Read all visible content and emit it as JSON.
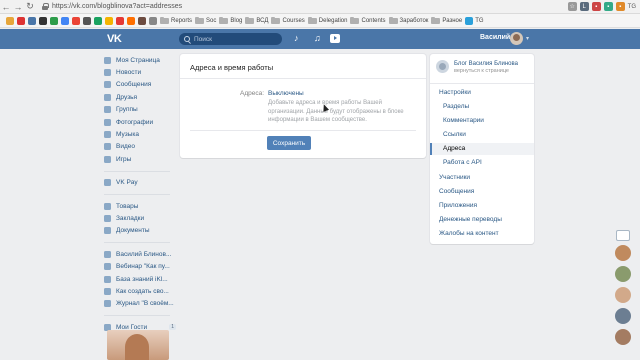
{
  "browser": {
    "url": "https://vk.com/blogblinova?act=addresses",
    "right_tg": "TG",
    "bookmarks": [
      "Reports",
      "Soc",
      "Blog",
      "ВСД",
      "Courses",
      "Delegation",
      "Contents",
      "Заработок",
      "Разное",
      "TG"
    ]
  },
  "vk_header": {
    "logo": "VK",
    "search_placeholder": "Поиск",
    "username": "Василий",
    "caret": "▾"
  },
  "left_nav": {
    "main": [
      "Моя Страница",
      "Новости",
      "Сообщения",
      "Друзья",
      "Группы",
      "Фотографии",
      "Музыка",
      "Видео",
      "Игры"
    ],
    "pay": "VK Pay",
    "extra": [
      "Товары",
      "Закладки",
      "Документы"
    ],
    "groups": [
      "Василий Блинов...",
      "Вебинар \"Как пу...",
      "База знаний iKl...",
      "Как создать сво...",
      "Журнал \"В своём..."
    ],
    "guests": "Мои Гости",
    "guests_badge": "1"
  },
  "card": {
    "title": "Адреса и время работы",
    "label": "Адреса:",
    "value": "Выключены",
    "description": "Добавьте адреса и время работы Вашей организации. Данные будут отображены в блоке информации в Вашем сообществе.",
    "save": "Сохранить"
  },
  "right_menu": {
    "group_name": "Блог Василия Блинова",
    "back": "вернуться к странице",
    "settings": "Настройки",
    "sub": [
      "Разделы",
      "Комментарии",
      "Ссылки",
      "Адреса",
      "Работа с API"
    ],
    "active": "Адреса",
    "items": [
      "Участники",
      "Сообщения",
      "Приложения",
      "Денежные переводы",
      "Жалобы на контент"
    ]
  },
  "colors": {
    "vk_blue": "#4a76a8",
    "link": "#2a5885",
    "button": "#5181b8",
    "background": "#edeef0"
  }
}
